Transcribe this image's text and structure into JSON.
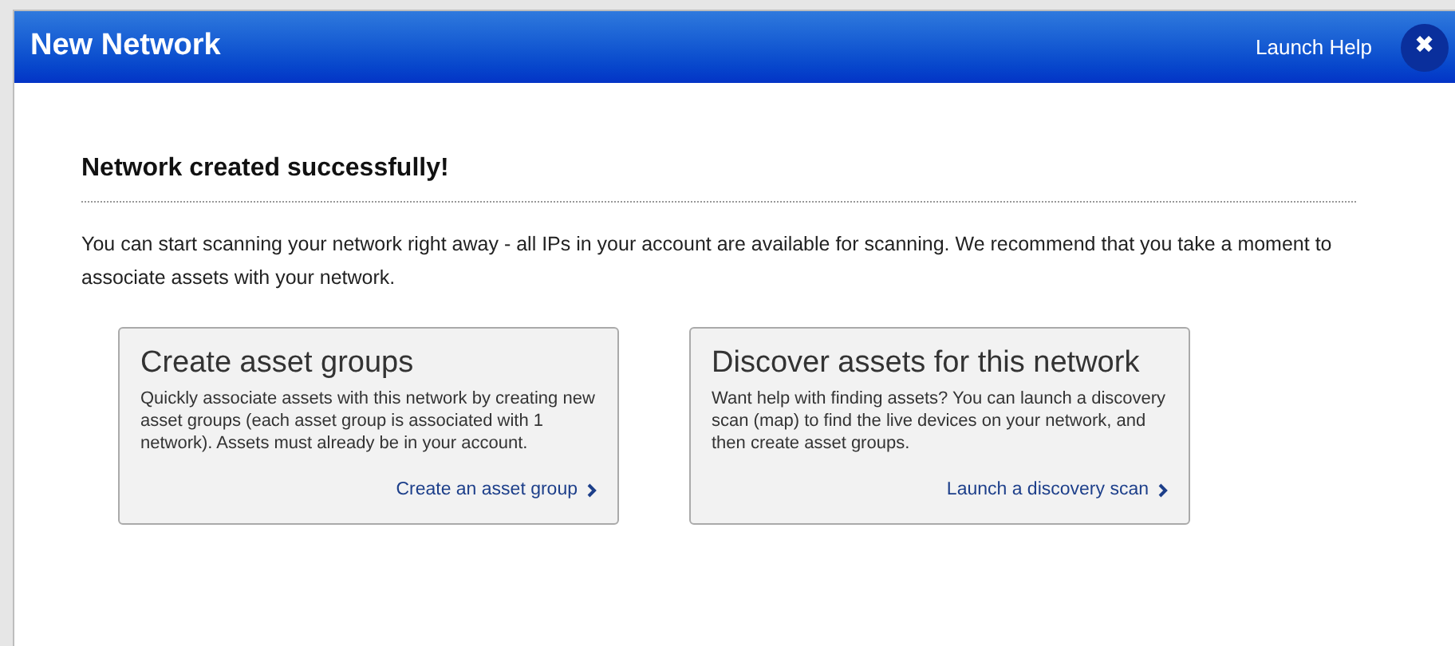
{
  "window": {
    "title": "New Network",
    "help_link": "Launch Help",
    "close_icon": "✖"
  },
  "heading": "Network created successfully!",
  "intro": "You can start scanning your network right away - all IPs in your account are available for scanning. We recommend that you take a moment to associate assets with your network.",
  "cards": [
    {
      "title": "Create asset groups",
      "text": "Quickly associate assets with this network by creating new asset groups (each asset group is associated with 1 network). Assets must already be in your account.",
      "link": "Create an asset group"
    },
    {
      "title": "Discover assets for this network",
      "text": "Want help with finding assets? You can launch a discovery scan (map) to find the live devices on your network, and then create asset groups.",
      "link": "Launch a discovery scan"
    }
  ]
}
